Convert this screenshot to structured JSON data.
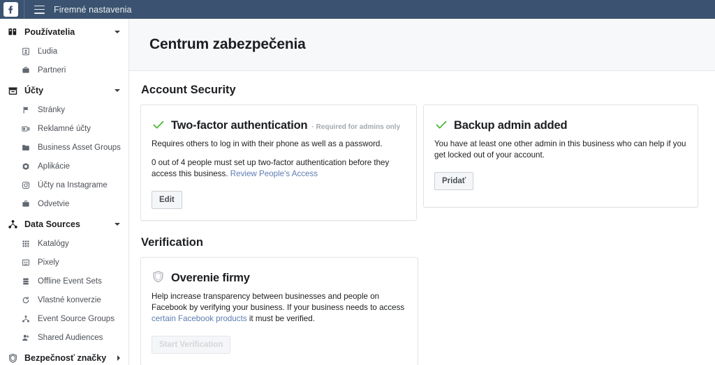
{
  "topbar": {
    "logo_icon": "facebook-logo-icon",
    "menu_icon": "hamburger-menu-icon",
    "title": "Firemné nastavenia"
  },
  "sidebar": {
    "groups": [
      {
        "label": "Používatelia",
        "icon": "users-icon",
        "caret": "chevron-down-icon",
        "items": [
          {
            "label": "Ľudia",
            "icon": "person-badge-icon"
          },
          {
            "label": "Partneri",
            "icon": "briefcase-icon"
          }
        ]
      },
      {
        "label": "Účty",
        "icon": "accounts-box-icon",
        "caret": "chevron-down-icon",
        "items": [
          {
            "label": "Stránky",
            "icon": "flag-icon"
          },
          {
            "label": "Reklamné účty",
            "icon": "ad-account-icon"
          },
          {
            "label": "Business Asset Groups",
            "icon": "folder-icon"
          },
          {
            "label": "Aplikácie",
            "icon": "app-cube-icon"
          },
          {
            "label": "Účty na Instagrame",
            "icon": "instagram-icon"
          },
          {
            "label": "Odvetvie",
            "icon": "briefcase-icon"
          }
        ]
      },
      {
        "label": "Data Sources",
        "icon": "data-sources-icon",
        "caret": "chevron-down-icon",
        "items": [
          {
            "label": "Katalógy",
            "icon": "grid-icon"
          },
          {
            "label": "Pixely",
            "icon": "pixel-icon"
          },
          {
            "label": "Offline Event Sets",
            "icon": "stack-icon"
          },
          {
            "label": "Vlastné konverzie",
            "icon": "refresh-icon"
          },
          {
            "label": "Event Source Groups",
            "icon": "event-source-icon"
          },
          {
            "label": "Shared Audiences",
            "icon": "shared-audience-icon"
          }
        ]
      },
      {
        "label": "Bezpečnosť značky",
        "icon": "shield-icon",
        "caret": "chevron-right-icon",
        "items": []
      }
    ]
  },
  "page": {
    "title": "Centrum zabezpečenia"
  },
  "sections": {
    "account_security": {
      "title": "Account Security",
      "tfa_card": {
        "status_icon": "green-check-icon",
        "title": "Two-factor authentication",
        "subtitle": "· Required for admins only",
        "desc1": "Requires others to log in with their phone as well as a password.",
        "desc2_before": "0 out of 4 people must set up two-factor authentication before they access this business.",
        "desc2_link": "Review People's Access",
        "button": "Edit"
      },
      "backup_card": {
        "status_icon": "green-check-icon",
        "title": "Backup admin added",
        "desc": "You have at least one other admin in this business who can help if you get locked out of your account.",
        "button": "Pridať"
      }
    },
    "verification": {
      "title": "Verification",
      "card": {
        "status_icon": "shield-outline-icon",
        "title": "Overenie firmy",
        "desc_before": "Help increase transparency between businesses and people on Facebook by verifying your business. If your business needs to access ",
        "desc_link": "certain Facebook products",
        "desc_after": " it must be verified.",
        "button": "Start Verification"
      }
    }
  },
  "colors": {
    "topbar_bg": "#3b5370",
    "accent_green": "#42b72a",
    "link_blue": "#5c7cb1",
    "page_head_bg": "#f7f8fa",
    "border": "#e1e3e6"
  }
}
